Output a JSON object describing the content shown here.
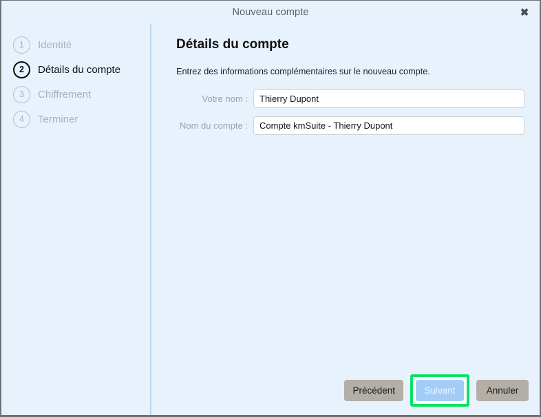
{
  "window": {
    "title": "Nouveau compte",
    "close_icon": "close-icon",
    "close_glyph": "✖"
  },
  "sidebar": {
    "steps": [
      {
        "number": "1",
        "label": "Identité",
        "state": "inactive"
      },
      {
        "number": "2",
        "label": "Détails du compte",
        "state": "active"
      },
      {
        "number": "3",
        "label": "Chiffrement",
        "state": "inactive"
      },
      {
        "number": "4",
        "label": "Terminer",
        "state": "inactive"
      }
    ]
  },
  "main": {
    "heading": "Détails du compte",
    "subtitle": "Entrez des informations complémentaires sur le nouveau compte.",
    "fields": [
      {
        "label": "Votre nom :",
        "value": "Thierry Dupont",
        "placeholder": ""
      },
      {
        "label": "Nom du compte :",
        "value": "Compte kmSuite - Thierry Dupont",
        "placeholder": ""
      }
    ]
  },
  "footer": {
    "back_label": "Précédent",
    "next_label": "Suivant",
    "cancel_label": "Annuler"
  },
  "colors": {
    "background": "#e8f2fd",
    "divider": "#b9d8f0",
    "window_border": "#6e7174",
    "button_grey": "#b3aea6",
    "button_primary": "#a3ccf7",
    "highlight_green": "#00e561",
    "step_inactive": "#a8b0b8",
    "step_active": "#101010",
    "label_grey": "#9aa2ab"
  }
}
